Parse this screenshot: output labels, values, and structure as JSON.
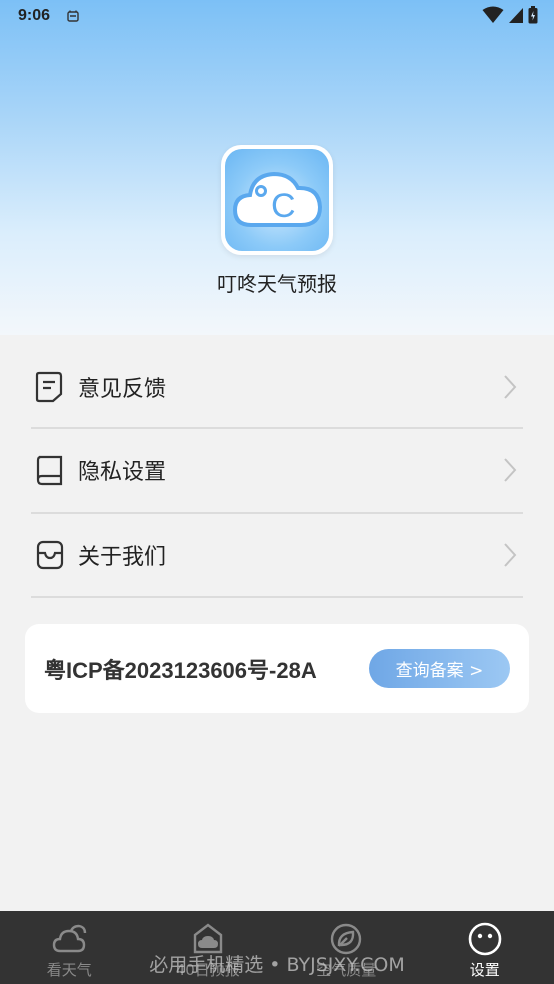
{
  "status_bar": {
    "time": "9:06"
  },
  "app": {
    "name": "叮咚天气预报",
    "icon_text": "°C"
  },
  "menu": [
    {
      "label": "意见反馈",
      "icon": "feedback-icon"
    },
    {
      "label": "隐私设置",
      "icon": "privacy-book-icon"
    },
    {
      "label": "关于我们",
      "icon": "about-box-icon"
    }
  ],
  "icp": {
    "number": "粤ICP备2023123606号-28A",
    "button": "查询备案 >"
  },
  "tabs": [
    {
      "label": "看天气",
      "icon": "cloud-sun-icon",
      "active": false
    },
    {
      "label": "40日预报",
      "icon": "forecast-calendar-icon",
      "active": false
    },
    {
      "label": "空气质量",
      "icon": "leaf-icon",
      "active": false
    },
    {
      "label": "设置",
      "icon": "smiley-settings-icon",
      "active": true
    }
  ],
  "watermark": "必用手机精选 • BYJSJXY.COM",
  "colors": {
    "tab_bg": "#333333",
    "accent": "#6fa7e6",
    "header_top": "#7cc0f6"
  }
}
